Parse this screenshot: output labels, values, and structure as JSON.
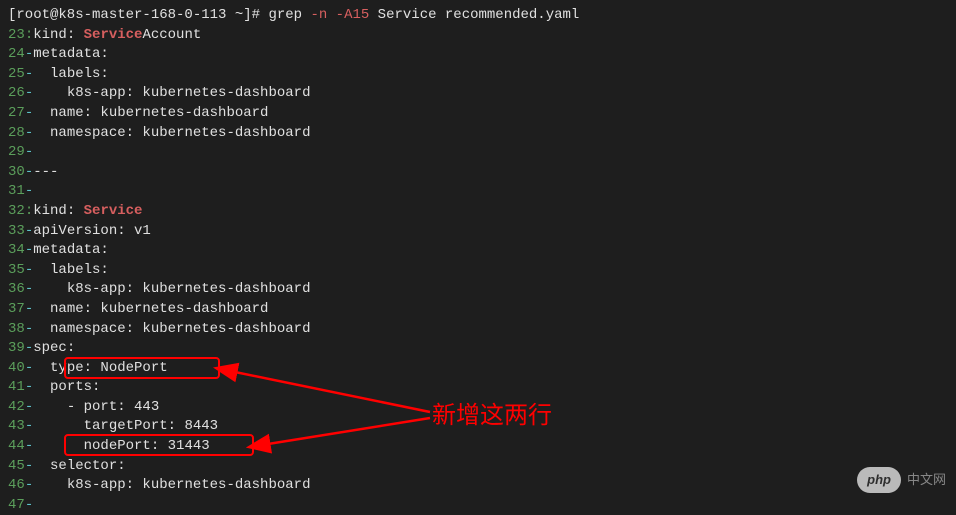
{
  "prompt": {
    "user_host": "[root@k8s-master-168-0-113 ~]# ",
    "command": "grep ",
    "flag": "-n -A15",
    "args": " Service recommended.yaml"
  },
  "lines": [
    {
      "no": "23",
      "sep": ":",
      "segments": [
        {
          "t": "kind: ",
          "c": "text-normal"
        },
        {
          "t": "Service",
          "c": "text-highlight"
        },
        {
          "t": "Account",
          "c": "text-normal"
        }
      ]
    },
    {
      "no": "24",
      "sep": "-",
      "segments": [
        {
          "t": "metadata:",
          "c": "text-normal"
        }
      ]
    },
    {
      "no": "25",
      "sep": "-",
      "segments": [
        {
          "t": "  labels:",
          "c": "text-normal"
        }
      ]
    },
    {
      "no": "26",
      "sep": "-",
      "segments": [
        {
          "t": "    k8s-app: kubernetes-dashboard",
          "c": "text-normal"
        }
      ]
    },
    {
      "no": "27",
      "sep": "-",
      "segments": [
        {
          "t": "  name: kubernetes-dashboard",
          "c": "text-normal"
        }
      ]
    },
    {
      "no": "28",
      "sep": "-",
      "segments": [
        {
          "t": "  namespace: kubernetes-dashboard",
          "c": "text-normal"
        }
      ]
    },
    {
      "no": "29",
      "sep": "-",
      "segments": [
        {
          "t": "",
          "c": "text-normal"
        }
      ]
    },
    {
      "no": "30",
      "sep": "-",
      "segments": [
        {
          "t": "---",
          "c": "text-normal"
        }
      ]
    },
    {
      "no": "31",
      "sep": "-",
      "segments": [
        {
          "t": "",
          "c": "text-normal"
        }
      ]
    },
    {
      "no": "32",
      "sep": ":",
      "segments": [
        {
          "t": "kind: ",
          "c": "text-normal"
        },
        {
          "t": "Service",
          "c": "text-highlight"
        }
      ]
    },
    {
      "no": "33",
      "sep": "-",
      "segments": [
        {
          "t": "apiVersion: v1",
          "c": "text-normal"
        }
      ]
    },
    {
      "no": "34",
      "sep": "-",
      "segments": [
        {
          "t": "metadata:",
          "c": "text-normal"
        }
      ]
    },
    {
      "no": "35",
      "sep": "-",
      "segments": [
        {
          "t": "  labels:",
          "c": "text-normal"
        }
      ]
    },
    {
      "no": "36",
      "sep": "-",
      "segments": [
        {
          "t": "    k8s-app: kubernetes-dashboard",
          "c": "text-normal"
        }
      ]
    },
    {
      "no": "37",
      "sep": "-",
      "segments": [
        {
          "t": "  name: kubernetes-dashboard",
          "c": "text-normal"
        }
      ]
    },
    {
      "no": "38",
      "sep": "-",
      "segments": [
        {
          "t": "  namespace: kubernetes-dashboard",
          "c": "text-normal"
        }
      ]
    },
    {
      "no": "39",
      "sep": "-",
      "segments": [
        {
          "t": "spec:",
          "c": "text-normal"
        }
      ]
    },
    {
      "no": "40",
      "sep": "-",
      "segments": [
        {
          "t": "  type: NodePort",
          "c": "text-normal"
        }
      ]
    },
    {
      "no": "41",
      "sep": "-",
      "segments": [
        {
          "t": "  ports:",
          "c": "text-normal"
        }
      ]
    },
    {
      "no": "42",
      "sep": "-",
      "segments": [
        {
          "t": "    - port: 443",
          "c": "text-normal"
        }
      ]
    },
    {
      "no": "43",
      "sep": "-",
      "segments": [
        {
          "t": "      targetPort: 8443",
          "c": "text-normal"
        }
      ]
    },
    {
      "no": "44",
      "sep": "-",
      "segments": [
        {
          "t": "      nodePort: 31443",
          "c": "text-normal"
        }
      ]
    },
    {
      "no": "45",
      "sep": "-",
      "segments": [
        {
          "t": "  selector:",
          "c": "text-normal"
        }
      ]
    },
    {
      "no": "46",
      "sep": "-",
      "segments": [
        {
          "t": "    k8s-app: kubernetes-dashboard",
          "c": "text-normal"
        }
      ]
    },
    {
      "no": "47",
      "sep": "-",
      "segments": [
        {
          "t": "",
          "c": "text-normal"
        }
      ]
    }
  ],
  "annotation": "新增这两行",
  "watermark": {
    "logo": "php",
    "text": "中文网"
  }
}
